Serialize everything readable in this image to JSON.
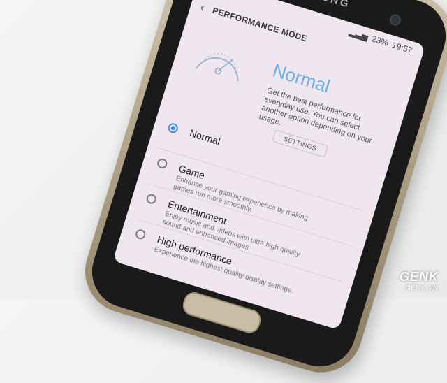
{
  "device": {
    "brand": "SAMSUNG"
  },
  "status_bar": {
    "signal": "▂▃▅",
    "battery": "23%",
    "time": "19:57"
  },
  "app_bar": {
    "back_icon": "arrow-left-icon",
    "title": "PERFORMANCE MODE"
  },
  "hero": {
    "icon": "gauge-icon",
    "title": "Normal",
    "description": "Get the best performance for everyday use. You can select another option depending on your usage.",
    "settings_label": "SETTINGS"
  },
  "options": [
    {
      "title": "Normal",
      "description": "",
      "selected": true
    },
    {
      "title": "Game",
      "description": "Enhance your gaming experience by making games run more smoothly.",
      "selected": false
    },
    {
      "title": "Entertainment",
      "description": "Enjoy music and videos with ultra high quality sound and enhanced images.",
      "selected": false
    },
    {
      "title": "High performance",
      "description": "Experience the highest quality display settings.",
      "selected": false
    }
  ],
  "colors": {
    "accent": "#3b8ee8",
    "hero_title": "#6aaee8",
    "screen_bg": "#efe6f0"
  },
  "watermark": {
    "main": "GENK",
    "sub": "GENK.VN"
  }
}
